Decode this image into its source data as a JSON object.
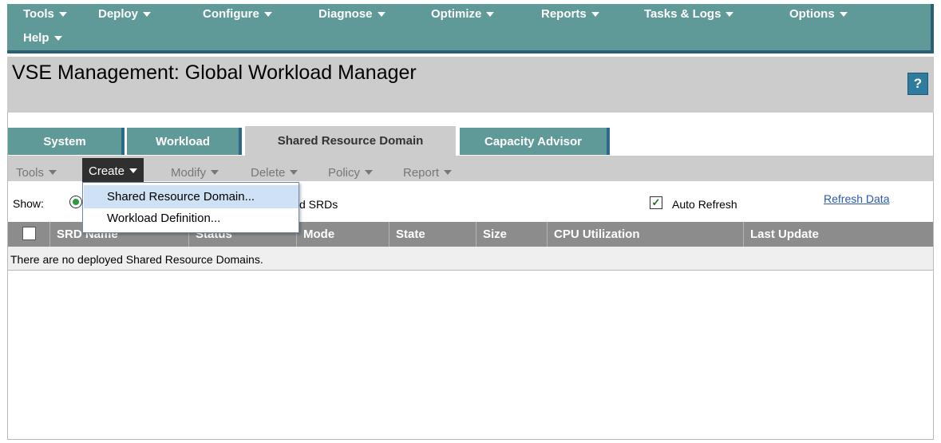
{
  "top_menu": {
    "items": [
      {
        "label": "Tools"
      },
      {
        "label": "Deploy"
      },
      {
        "label": "Configure"
      },
      {
        "label": "Diagnose"
      },
      {
        "label": "Optimize"
      },
      {
        "label": "Reports"
      },
      {
        "label": "Tasks & Logs"
      },
      {
        "label": "Options"
      },
      {
        "label": "Help"
      }
    ]
  },
  "header": {
    "title": "VSE Management: Global Workload Manager",
    "help_label": "?"
  },
  "tabs": [
    {
      "label": "System",
      "active": false
    },
    {
      "label": "Workload",
      "active": false
    },
    {
      "label": "Shared Resource Domain",
      "active": true
    },
    {
      "label": "Capacity Advisor",
      "active": false
    }
  ],
  "toolbar": {
    "items": [
      {
        "label": "Tools"
      },
      {
        "label": "Create",
        "active": true
      },
      {
        "label": "Modify"
      },
      {
        "label": "Delete"
      },
      {
        "label": "Policy"
      },
      {
        "label": "Report"
      }
    ]
  },
  "create_menu": {
    "items": [
      {
        "label": "Shared Resource Domain...",
        "highlighted": true
      },
      {
        "label": "Workload Definition..."
      }
    ]
  },
  "filter": {
    "show_label": "Show:",
    "partial_option_text": "d SRDs",
    "auto_refresh_label": "Auto Refresh",
    "auto_refresh_checked": true,
    "refresh_link": "Refresh Data"
  },
  "table": {
    "columns": [
      "SRD Name",
      "Status",
      "Mode",
      "State",
      "Size",
      "CPU Utilization",
      "Last Update"
    ],
    "empty_message": "There are no deployed Shared Resource Domains."
  },
  "colors": {
    "menu_bg": "#5f9a99",
    "menu_border": "#2d5f74",
    "tab_active_bg": "#cccccc",
    "header_bg": "#8c8c8c",
    "link": "#2a5aa8",
    "highlight": "#cfe1f5"
  },
  "icons": [
    "caret-down-icon",
    "help-icon",
    "checkbox-icon",
    "radio-icon"
  ]
}
